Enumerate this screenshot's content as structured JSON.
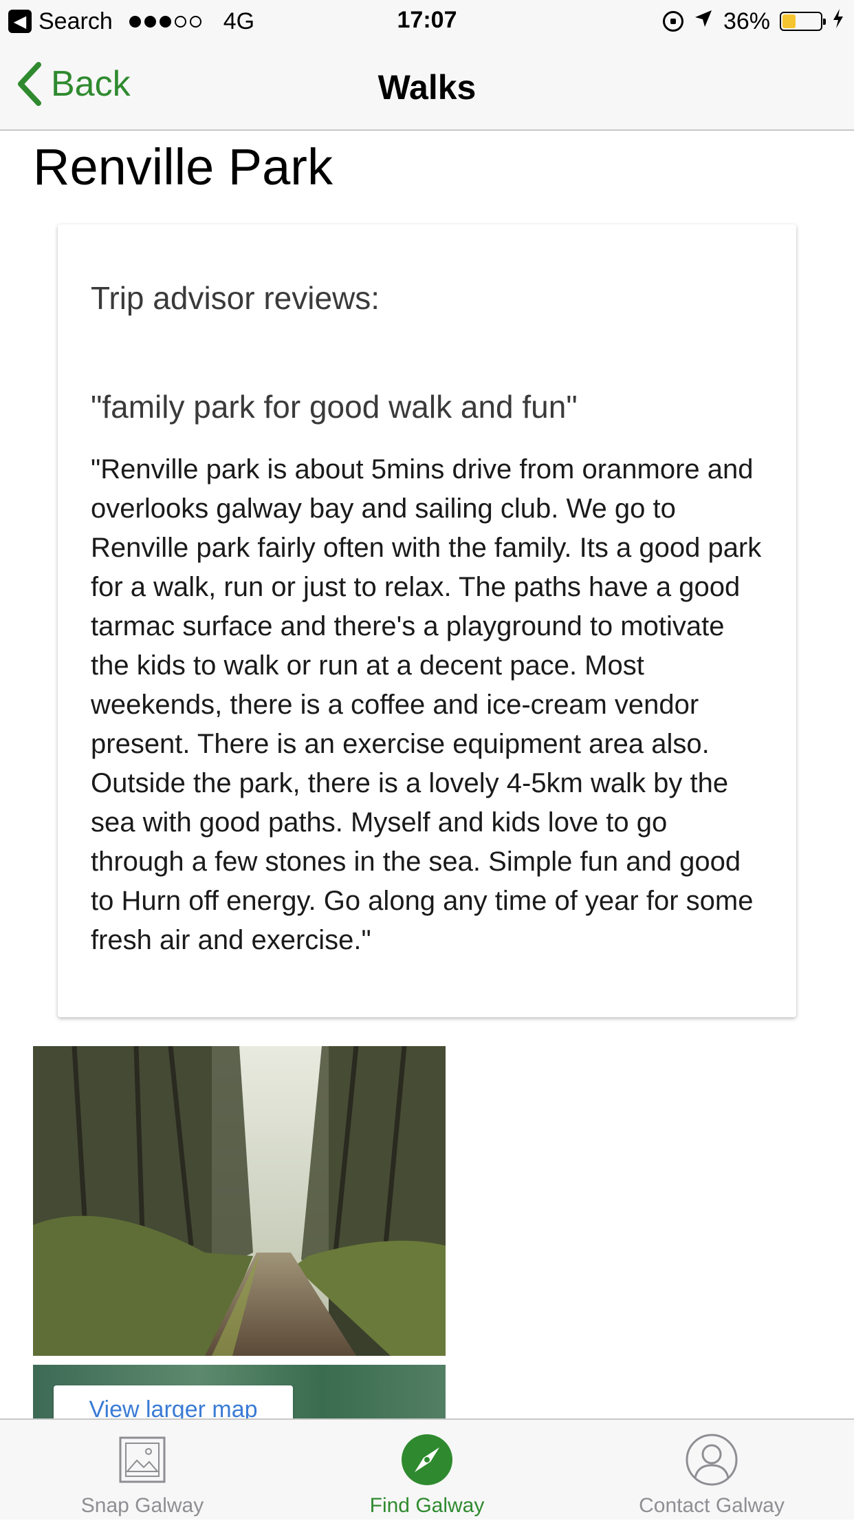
{
  "status_bar": {
    "back_app": "Search",
    "network": "4G",
    "time": "17:07",
    "battery": "36%",
    "battery_level": 0.36,
    "signal_bars": 3,
    "signal_total": 5
  },
  "nav": {
    "back_label": "Back",
    "title": "Walks"
  },
  "page": {
    "title": "Renville Park"
  },
  "review": {
    "heading": "Trip advisor reviews:",
    "quote": "\"family park for good walk and fun\"",
    "body": "\"Renville park is about 5mins drive from oranmore and overlooks galway bay and sailing club. We go to Renville park fairly often with the family. Its a good park for a walk, run or just to relax. The paths have a good tarmac surface and there's a playground to motivate the kids to walk or run at a decent pace. Most weekends, there is a coffee and ice-cream vendor present. There is an exercise equipment area also. Outside the park, there is a lovely 4-5km walk by the sea with good paths. Myself and kids love to go through a few stones in the sea. Simple fun and good to Hurn off energy. Go along any time of year for some fresh air and exercise.\""
  },
  "map": {
    "button_label": "View larger map"
  },
  "tabs": [
    {
      "label": "Snap Galway",
      "icon": "image-icon",
      "active": false
    },
    {
      "label": "Find Galway",
      "icon": "compass-icon",
      "active": true
    },
    {
      "label": "Contact Galway",
      "icon": "person-icon",
      "active": false
    }
  ],
  "colors": {
    "accent": "#2f8a2f",
    "inactive_tab": "#8e8e93",
    "battery_fill": "#f5c431",
    "link": "#3a7bd5"
  }
}
